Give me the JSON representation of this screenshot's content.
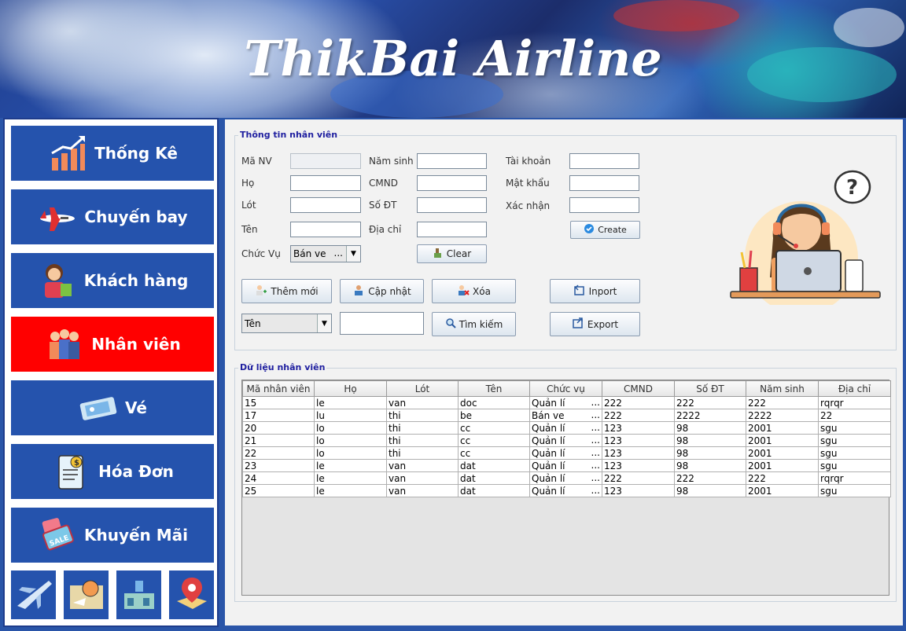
{
  "header": {
    "title": "ThikBai Airline"
  },
  "sidebar": {
    "items": [
      {
        "label": "Thống Kê",
        "icon": "bar-chart-icon",
        "active": false
      },
      {
        "label": "Chuyến bay",
        "icon": "airplane-icon",
        "active": false
      },
      {
        "label": "Khách hàng",
        "icon": "customer-icon",
        "active": false
      },
      {
        "label": "Nhân viên",
        "icon": "staff-icon",
        "active": true
      },
      {
        "label": "Vé",
        "icon": "ticket-icon",
        "active": false
      },
      {
        "label": "Hóa Đơn",
        "icon": "invoice-icon",
        "active": false
      },
      {
        "label": "Khuyến Mãi",
        "icon": "sale-tag-icon",
        "active": false
      }
    ],
    "mini_buttons": [
      "plane-icon",
      "globe-map-icon",
      "airport-icon",
      "location-pin-icon"
    ]
  },
  "form": {
    "group_title": "Thông tin nhân viên",
    "labels": {
      "ma_nv": "Mã NV",
      "ho": "Họ",
      "lot": "Lót",
      "ten": "Tên",
      "chuc_vu": "Chức Vụ",
      "nam_sinh": "Năm sinh",
      "cmnd": "CMND",
      "so_dt": "Số ĐT",
      "dia_chi": "Địa chỉ",
      "tai_khoan": "Tài khoản",
      "mat_khau": "Mật khẩu",
      "xac_nhan": "Xác nhận"
    },
    "values": {
      "ma_nv": "",
      "ho": "",
      "lot": "",
      "ten": "",
      "chuc_vu": "Bán ve",
      "nam_sinh": "",
      "cmnd": "",
      "so_dt": "",
      "dia_chi": "",
      "tai_khoan": "",
      "mat_khau": "",
      "xac_nhan": ""
    },
    "buttons": {
      "create": "Create",
      "clear": "Clear",
      "them_moi": "Thêm mới",
      "cap_nhat": "Cập nhật",
      "xoa": "Xóa",
      "inport": "Inport",
      "tim_kiem": "Tìm kiếm",
      "export": "Export"
    },
    "search": {
      "field": "Tên",
      "value": ""
    }
  },
  "table": {
    "group_title": "Dữ liệu nhân viên",
    "columns": [
      "Mã nhân viên",
      "Họ",
      "Lót",
      "Tên",
      "Chức vụ",
      "CMND",
      "Số ĐT",
      "Năm sinh",
      "Địa chỉ"
    ],
    "rows": [
      [
        "15",
        "le",
        "van",
        "doc",
        "Quản lí",
        "222",
        "222",
        "222",
        "rqrqr"
      ],
      [
        "17",
        "lu",
        "thi",
        "be",
        "Bán ve",
        "222",
        "2222",
        "2222",
        "22"
      ],
      [
        "20",
        "lo",
        "thi",
        "cc",
        "Quản lí",
        "123",
        "98",
        "2001",
        "sgu"
      ],
      [
        "21",
        "lo",
        "thi",
        "cc",
        "Quản lí",
        "123",
        "98",
        "2001",
        "sgu"
      ],
      [
        "22",
        "lo",
        "thi",
        "cc",
        "Quản lí",
        "123",
        "98",
        "2001",
        "sgu"
      ],
      [
        "23",
        "le",
        "van",
        "dat",
        "Quản lí",
        "123",
        "98",
        "2001",
        "sgu"
      ],
      [
        "24",
        "le",
        "van",
        "dat",
        "Quản lí",
        "222",
        "222",
        "222",
        "rqrqr"
      ],
      [
        "25",
        "le",
        "van",
        "dat",
        "Quản lí",
        "123",
        "98",
        "2001",
        "sgu"
      ]
    ]
  },
  "colors": {
    "nav_bg": "#2553ad",
    "nav_active": "#ff0000",
    "group_title": "#2020a0"
  }
}
